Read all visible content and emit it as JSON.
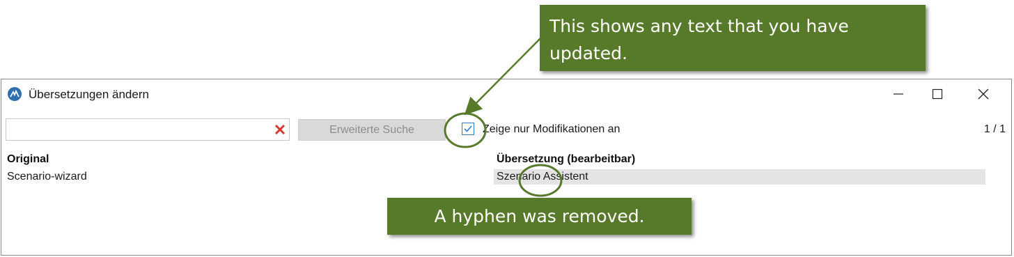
{
  "window": {
    "title": "Übersetzungen ändern",
    "app_icon": "app-logo-icon",
    "controls": [
      "minimize-icon",
      "maximize-icon",
      "close-icon"
    ]
  },
  "toolbar": {
    "search_value": "",
    "clear_icon": "clear-x-icon",
    "advanced_search_label": "Erweiterte Suche",
    "modifications_checkbox_label": "Zeige nur Modifikationen an",
    "modifications_checked": true,
    "page_counter": "1 / 1"
  },
  "table": {
    "headers": {
      "original": "Original",
      "translation": "Übersetzung (bearbeitbar)"
    },
    "rows": [
      {
        "original": "Scenario-wizard",
        "translation": "Szenario Assistent"
      }
    ]
  },
  "annotations": {
    "top_callout": "This shows any text that you have updated.",
    "bottom_callout": "A hyphen was removed.",
    "color": "#57792a"
  }
}
